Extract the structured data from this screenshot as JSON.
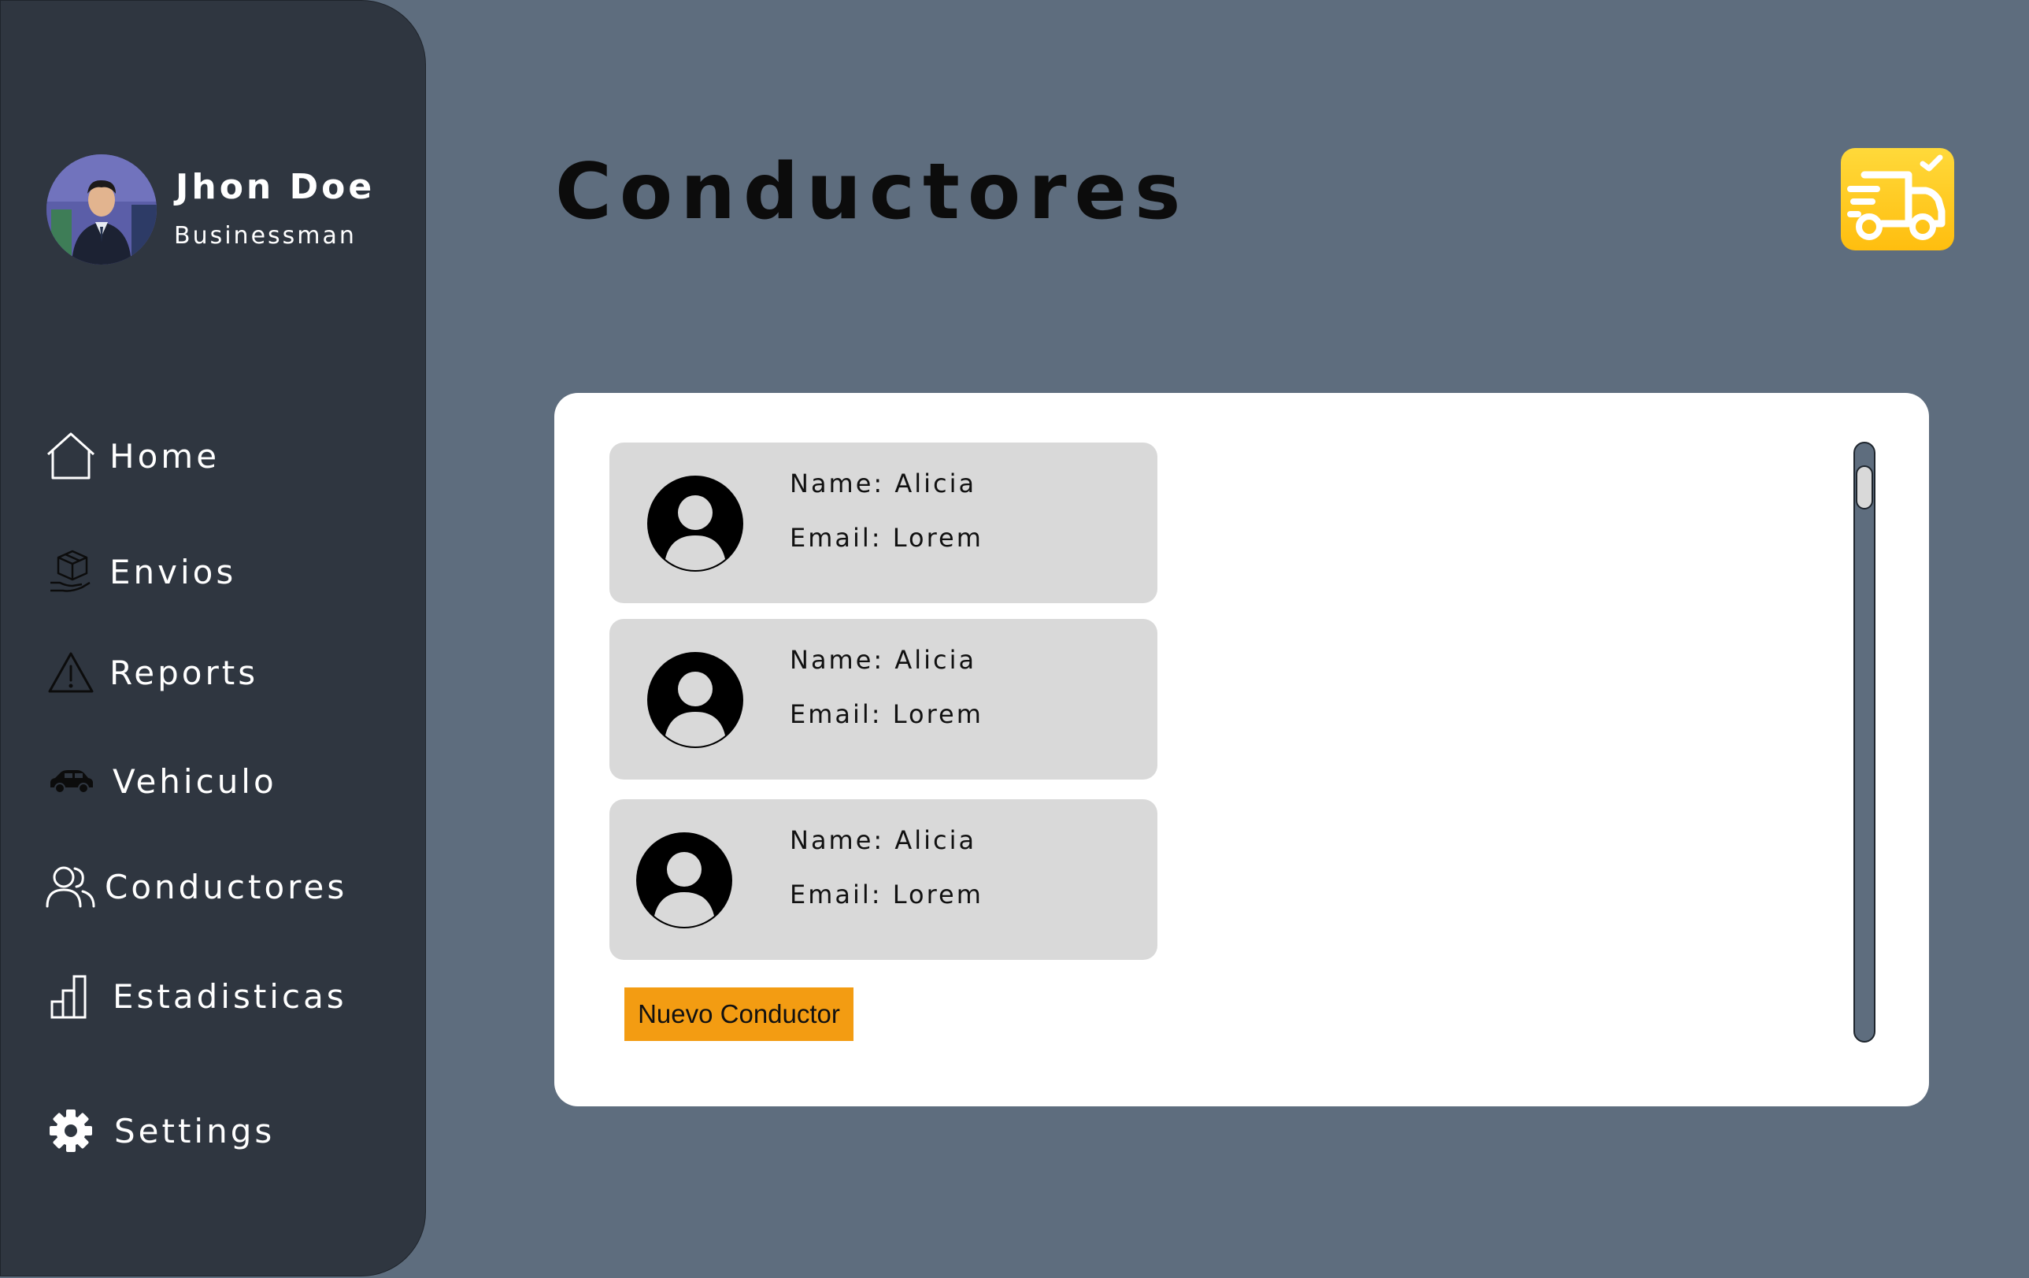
{
  "profile": {
    "name": "Jhon Doe",
    "role": "Businessman"
  },
  "nav": {
    "items": [
      {
        "label": "Home",
        "icon": "home-icon"
      },
      {
        "label": "Envios",
        "icon": "package-icon"
      },
      {
        "label": "Reports",
        "icon": "warning-icon"
      },
      {
        "label": "Vehiculo",
        "icon": "car-icon"
      },
      {
        "label": "Conductores",
        "icon": "users-icon"
      },
      {
        "label": "Estadisticas",
        "icon": "bar-chart-icon"
      },
      {
        "label": "Settings",
        "icon": "gear-icon"
      }
    ]
  },
  "header": {
    "title": "Conductores",
    "logo_icon": "delivery-truck-icon"
  },
  "drivers": [
    {
      "name": "Name: Alicia",
      "email": "Email: Lorem"
    },
    {
      "name": "Name: Alicia",
      "email": "Email: Lorem"
    },
    {
      "name": "Name: Alicia",
      "email": "Email: Lorem"
    }
  ],
  "actions": {
    "new_driver_label": "Nuevo Conductor"
  },
  "colors": {
    "background": "#5e6d7e",
    "sidebar": "#2f3640",
    "card": "#d9d9d9",
    "accent_button": "#f39c12",
    "logo_badge": "#ffc21a"
  }
}
